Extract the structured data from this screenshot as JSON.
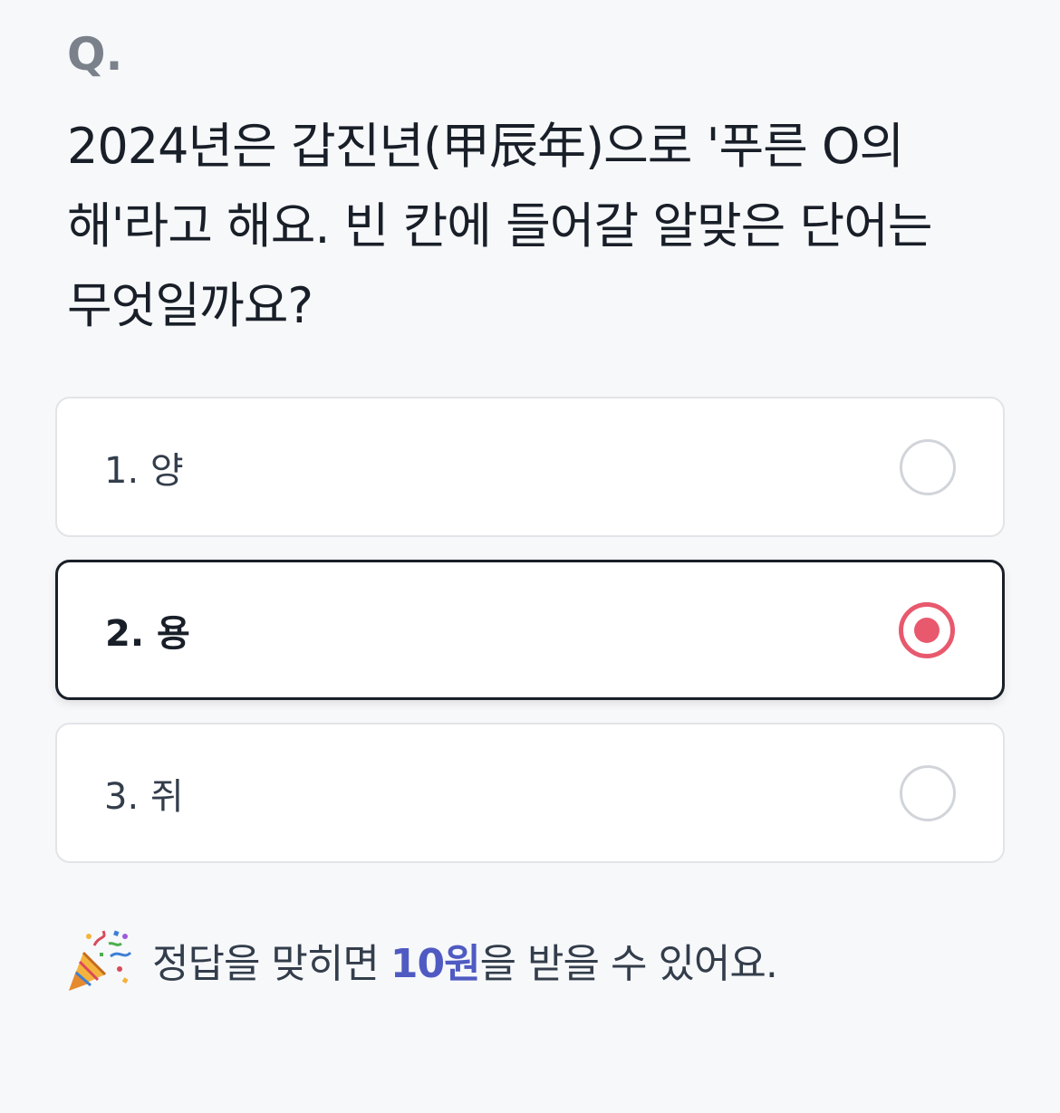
{
  "quiz": {
    "q_label": "Q.",
    "question": "2024년은 갑진년(甲辰年)으로 '푸른 O의 해'라고 해요. 빈 칸에 들어갈 알맞은 단어는 무엇일까요?",
    "options": [
      {
        "label": "1. 양",
        "selected": false
      },
      {
        "label": "2. 용",
        "selected": true
      },
      {
        "label": "3. 쥐",
        "selected": false
      }
    ]
  },
  "reward": {
    "icon": "party-popper-icon",
    "text_before": "정답을 맞히면 ",
    "amount": "10원",
    "text_after": "을 받을 수 있어요."
  },
  "colors": {
    "background": "#f7f8fa",
    "accent_radio": "#e8596e",
    "amount_text": "#4f5bc2",
    "q_label": "#7b818b"
  }
}
